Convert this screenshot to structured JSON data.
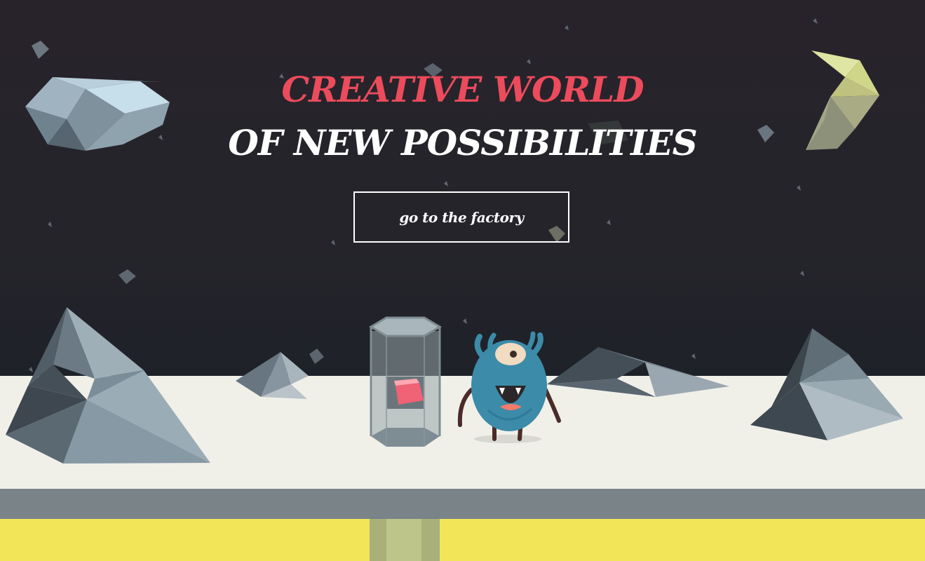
{
  "hero": {
    "title_accent": "CREATIVE WORLD",
    "title_main": "OF NEW POSSIBILITIES",
    "cta_label": "go to the factory"
  },
  "colors": {
    "sky": "#26222a",
    "accent": "#ec4b5c",
    "floor": "#f0f0ea",
    "floor_edge": "#7b8388",
    "pipe_band": "#f2e65a",
    "monster": "#3f8fab",
    "moon": "#c9c98a"
  },
  "icons": {
    "monster": "one-eyed-blue-monster",
    "tube": "glass-tube-with-red-block",
    "moon": "lowpoly-crescent-moon"
  }
}
